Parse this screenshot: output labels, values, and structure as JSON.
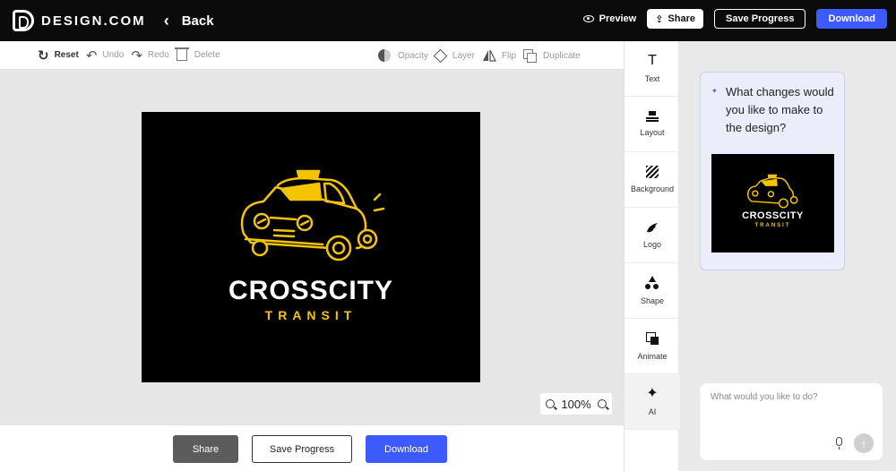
{
  "brand": {
    "name": "DESIGN.COM"
  },
  "header": {
    "back_label": "Back",
    "preview_label": "Preview",
    "share_label": "Share",
    "save_label": "Save Progress",
    "download_label": "Download"
  },
  "toolbar": {
    "reset": "Reset",
    "undo": "Undo",
    "redo": "Redo",
    "delete": "Delete",
    "opacity": "Opacity",
    "layer": "Layer",
    "flip": "Flip",
    "duplicate": "Duplicate"
  },
  "artboard": {
    "title": "CROSSCITY",
    "subtitle": "TRANSIT",
    "colors": {
      "background": "#000000",
      "accent": "#f4c400",
      "title": "#ffffff"
    }
  },
  "zoom": {
    "level": "100%"
  },
  "bottom": {
    "share_label": "Share",
    "save_label": "Save Progress",
    "download_label": "Download"
  },
  "side_tools": [
    {
      "label": "Text",
      "icon": "text-icon"
    },
    {
      "label": "Layout",
      "icon": "layout-icon"
    },
    {
      "label": "Background",
      "icon": "background-icon"
    },
    {
      "label": "Logo",
      "icon": "logo-icon"
    },
    {
      "label": "Shape",
      "icon": "shape-icon"
    },
    {
      "label": "Animate",
      "icon": "animate-icon"
    },
    {
      "label": "AI",
      "icon": "sparkle-icon"
    }
  ],
  "ai": {
    "question": "What changes would you like to make to the design?",
    "input_placeholder": "What would you like to do?",
    "input_value": ""
  },
  "colors": {
    "accent_blue": "#3d5afe",
    "topbar": "#0b0b0b"
  }
}
